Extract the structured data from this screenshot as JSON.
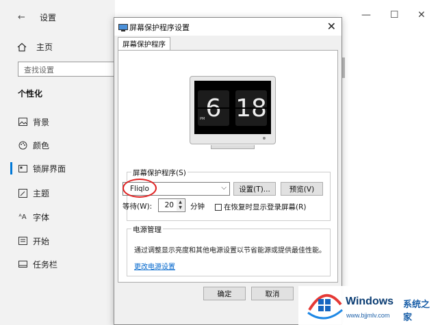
{
  "settings": {
    "title": "设置",
    "back_icon": "←",
    "home_label": "主页",
    "search_placeholder": "查找设置",
    "section": "个性化",
    "nav": [
      {
        "label": "背景",
        "icon": "image-icon"
      },
      {
        "label": "颜色",
        "icon": "palette-icon"
      },
      {
        "label": "锁屏界面",
        "icon": "lock-screen-icon",
        "active": true
      },
      {
        "label": "主题",
        "icon": "theme-icon"
      },
      {
        "label": "字体",
        "icon": "font-icon"
      },
      {
        "label": "开始",
        "icon": "start-icon"
      },
      {
        "label": "任务栏",
        "icon": "taskbar-icon"
      }
    ],
    "window_controls": {
      "minimize": "—",
      "maximize": "☐",
      "close": "✕"
    }
  },
  "dialog": {
    "title": "屏幕保护程序设置",
    "close": "✕",
    "tab": "屏幕保护程序",
    "preview": {
      "hour": "6",
      "minute": "18",
      "ampm": "PM"
    },
    "screensaver_group_label": "屏幕保护程序(S)",
    "screensaver_value": "Fliqlo",
    "settings_button": "设置(T)...",
    "preview_button": "预览(V)",
    "wait_label": "等待(W):",
    "wait_value": "20",
    "wait_unit": "分钟",
    "resume_checkbox_label": "在恢复时显示登录屏幕(R)",
    "resume_checked": false,
    "power_group_label": "电源管理",
    "power_text": "通过调整显示亮度和其他电源设置以节省能源或提供最佳性能。",
    "power_link": "更改电源设置",
    "ok_button": "确定",
    "cancel_button": "取消"
  },
  "watermark": {
    "brand": "Windows",
    "brand_cn": "系统之家",
    "url": "www.bjjmlv.com"
  },
  "colors": {
    "accent": "#0078d7",
    "highlight": "#e02020",
    "link": "#0066cc"
  }
}
